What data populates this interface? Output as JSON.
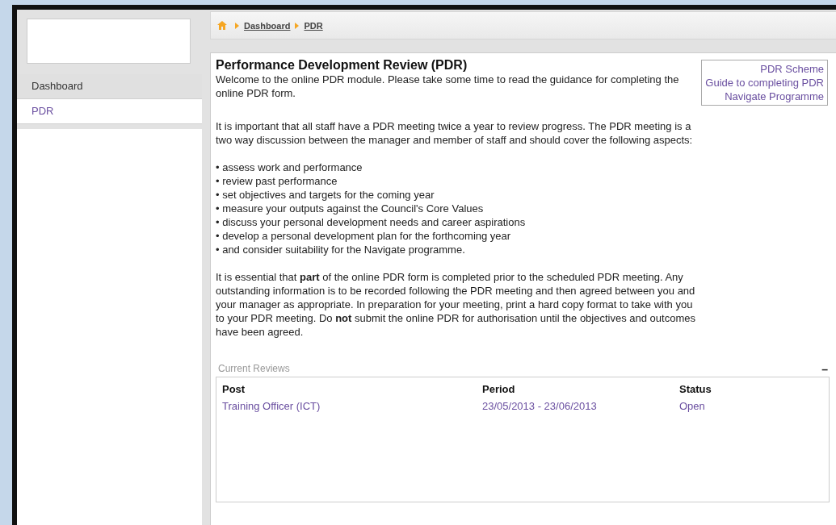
{
  "sidebar": {
    "items": [
      {
        "label": "Dashboard",
        "selected": false
      },
      {
        "label": "PDR",
        "selected": true
      }
    ]
  },
  "breadcrumb": [
    "Dashboard",
    "PDR"
  ],
  "title": "Performance Development Review (PDR)",
  "links": [
    "PDR Scheme",
    "Guide to completing PDR",
    "Navigate Programme"
  ],
  "intro": "Welcome to the online PDR module. Please take some time to read the guidance for completing the online PDR form.",
  "paragraph": "It is important that all staff have a PDR meeting twice a year to review progress. The PDR meeting is a two way discussion between the manager and member of staff and should cover the following aspects:",
  "bullets": [
    "• assess work and performance",
    "• review past performance",
    "• set objectives and targets for the coming year",
    "• measure your outputs against the Council's Core Values",
    "• discuss your personal development needs and career aspirations",
    "• develop a personal development plan for the forthcoming year",
    "• and consider suitability for the Navigate programme."
  ],
  "notice": "It is essential that **part** of the online PDR form is completed prior to the scheduled PDR meeting. Any outstanding information is to be recorded following the PDR meeting and then agreed between you and your manager as appropriate. In preparation for your meeting, print a hard copy format to take with you to your PDR meeting. Do **not** submit the online PDR for authorisation until the objectives and outcomes have been agreed.",
  "reviews": {
    "title": "Current Reviews",
    "collapse": "–",
    "columns": [
      "Post",
      "Period",
      "Status"
    ],
    "rows": [
      [
        "Training Officer (ICT)",
        "23/05/2013 - 23/06/2013",
        "Open"
      ]
    ]
  }
}
